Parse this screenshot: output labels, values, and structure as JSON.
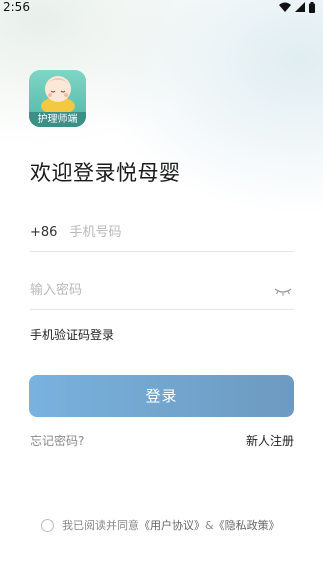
{
  "status_bar": {
    "time": "2:56",
    "icons": [
      "wifi-icon",
      "cell-signal-icon",
      "battery-icon"
    ]
  },
  "app": {
    "logo_label": "护理师端"
  },
  "title": "欢迎登录悦母婴",
  "phone": {
    "prefix": "+86",
    "placeholder": "手机号码",
    "value": ""
  },
  "password": {
    "placeholder": "输入密码",
    "value": "",
    "visibility_icon": "eye-closed-icon"
  },
  "sms_login_label": "手机验证码登录",
  "login_button": "登录",
  "forgot_password": "忘记密码?",
  "register": "新人注册",
  "agreement": {
    "prefix": "我已阅读并同意",
    "user_agreement": "《用户协议》",
    "conjunction": "&",
    "privacy_policy": "《隐私政策》",
    "checked": false
  },
  "colors": {
    "button_start": "#78b2de",
    "button_end": "#6d9ac0",
    "logo_bg": "#4fb7a6"
  }
}
